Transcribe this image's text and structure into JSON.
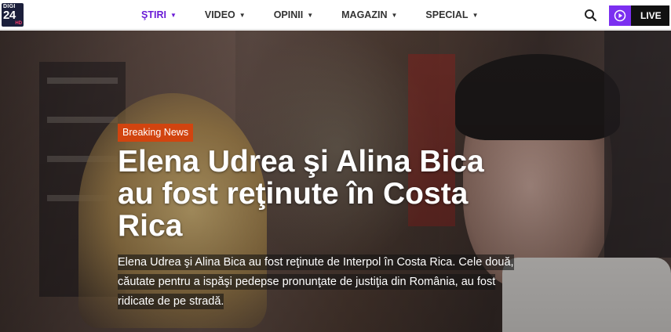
{
  "logo": {
    "line1": "DIGI",
    "line2": "24",
    "line3": "HD"
  },
  "nav": {
    "items": [
      {
        "label": "ŞTIRI",
        "active": true
      },
      {
        "label": "VIDEO",
        "active": false
      },
      {
        "label": "OPINII",
        "active": false
      },
      {
        "label": "MAGAZIN",
        "active": false
      },
      {
        "label": "SPECIAL",
        "active": false
      }
    ]
  },
  "header": {
    "search_icon": "search-icon",
    "live_label": "LIVE",
    "live_icon": "play-circle-icon"
  },
  "hero": {
    "badge": "Breaking News",
    "headline": "Elena Udrea şi Alina Bica au fost reţinute în Costa Rica",
    "summary": " Elena Udrea şi Alina Bica au fost reţinute de Interpol în Costa Rica. Cele două, căutate pentru a ispăşi pedepse pronunţate de justiţia din România, au fost ridicate de pe stradă."
  },
  "colors": {
    "accent": "#6a1bd6",
    "live_play": "#7b2ff0",
    "badge": "#d2440f"
  }
}
